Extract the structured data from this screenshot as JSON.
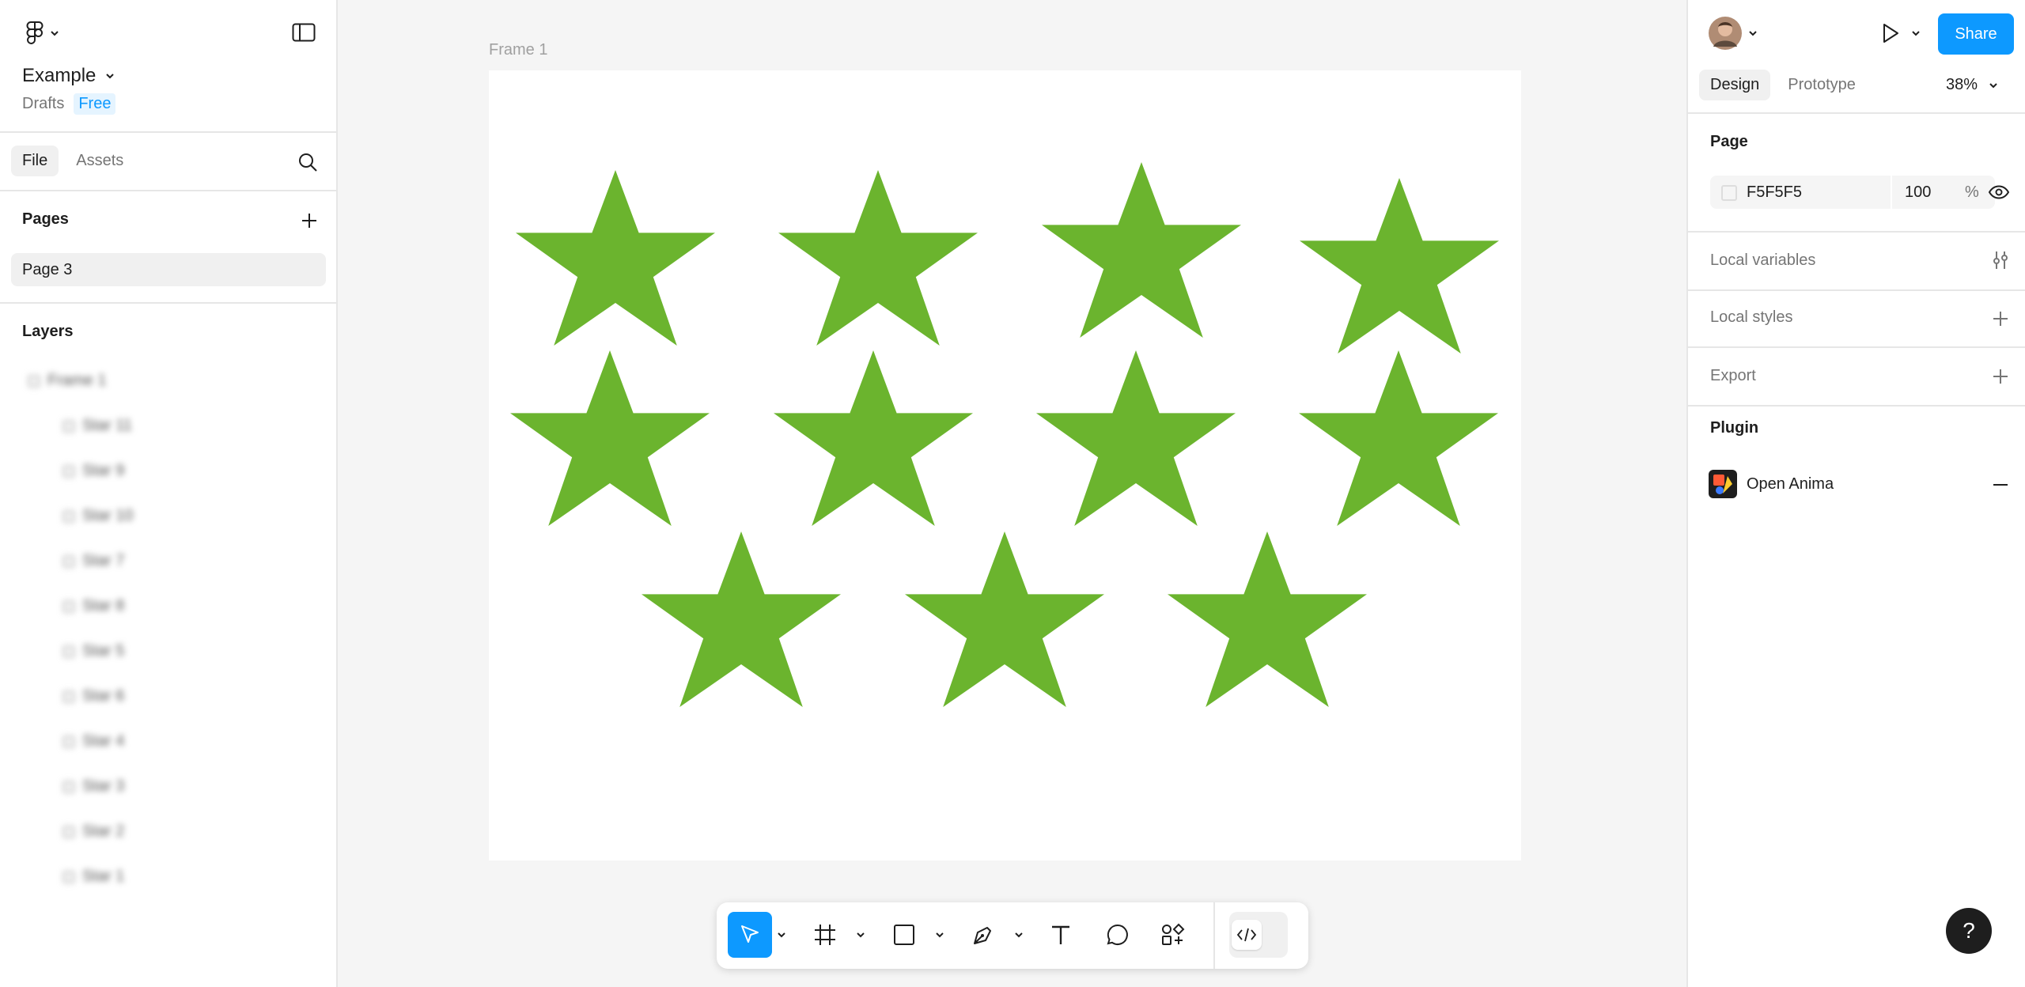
{
  "left": {
    "file_name": "Example",
    "drafts_label": "Drafts",
    "plan_badge": "Free",
    "tabs": [
      "File",
      "Assets"
    ],
    "pages_heading": "Pages",
    "current_page": "Page 3",
    "layers_heading": "Layers",
    "layers": [
      "Frame 1",
      "Star 11",
      "Star 9",
      "Star 10",
      "Star 7",
      "Star 8",
      "Star 5",
      "Star 6",
      "Star 4",
      "Star 3",
      "Star 2",
      "Star 1"
    ]
  },
  "right": {
    "tabs": [
      "Design",
      "Prototype"
    ],
    "zoom": "38%",
    "share_label": "Share",
    "page_heading": "Page",
    "page_color": "F5F5F5",
    "page_opacity": "100",
    "percent_sign": "%",
    "local_variables": "Local variables",
    "local_styles": "Local styles",
    "export": "Export",
    "plugin_heading": "Plugin",
    "plugin_name": "Open Anima"
  },
  "canvas": {
    "frame_label": "Frame 1",
    "star_color": "#6bb42e",
    "star_count": 11
  },
  "help_label": "?",
  "colors": {
    "accent": "#0d99ff",
    "star": "#6bb42e",
    "canvas_bg": "#f5f5f5"
  }
}
